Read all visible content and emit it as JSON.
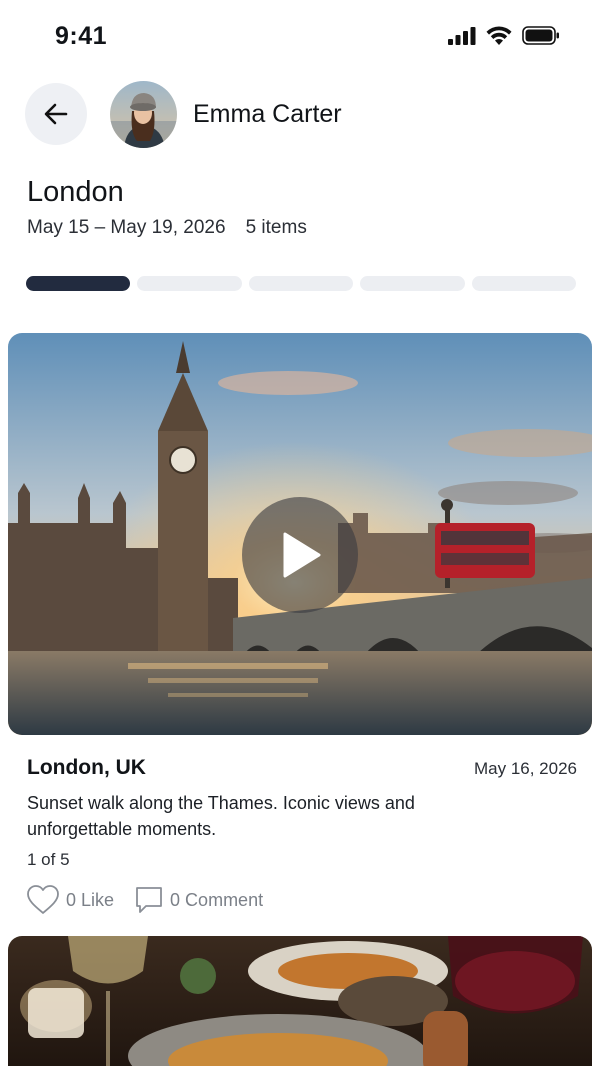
{
  "status": {
    "time": "9:41"
  },
  "header": {
    "user_name": "Emma Carter"
  },
  "trip": {
    "title": "London",
    "dates": "May 15 – May 19, 2026",
    "items_count": "5 items",
    "progress": {
      "current": 1,
      "total": 5
    }
  },
  "post": {
    "location": "London, UK",
    "date": "May 16, 2026",
    "caption": "Sunset walk along the Thames. Iconic views and unforgettable moments.",
    "counter": "1 of 5",
    "like_label": "0 Like",
    "comment_label": "0 Comment"
  },
  "colors": {
    "progress_active": "#222b3f",
    "progress_inactive": "#eceef2",
    "muted_text": "#7b8088"
  },
  "icons": [
    "signal-icon",
    "wifi-icon",
    "battery-icon",
    "back-arrow-icon",
    "play-icon",
    "heart-icon",
    "comment-icon"
  ]
}
